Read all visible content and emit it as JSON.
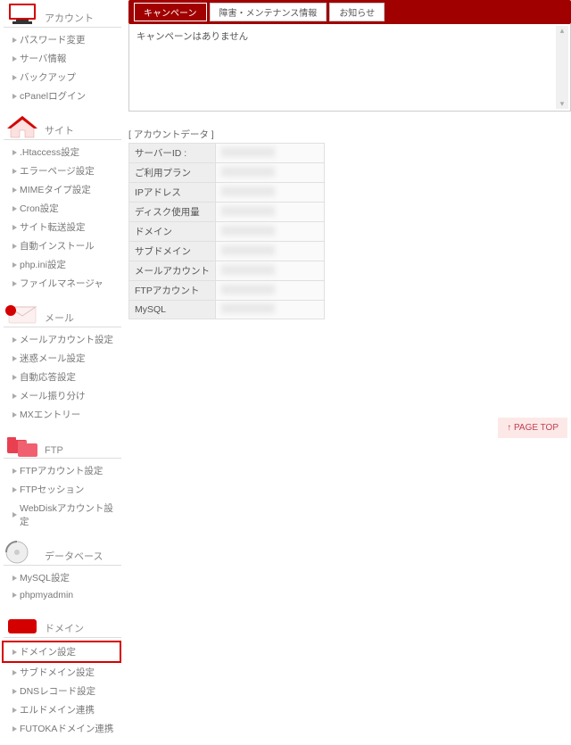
{
  "sidebar": {
    "account": {
      "label": "アカウント",
      "items": [
        "パスワード変更",
        "サーバ情報",
        "バックアップ",
        "cPanelログイン"
      ]
    },
    "site": {
      "label": "サイト",
      "items": [
        ".Htaccess設定",
        "エラーページ設定",
        "MIMEタイプ設定",
        "Cron設定",
        "サイト転送設定",
        "自動インストール",
        "php.ini設定",
        "ファイルマネージャ"
      ]
    },
    "mail": {
      "label": "メール",
      "items": [
        "メールアカウント設定",
        "迷惑メール設定",
        "自動応答設定",
        "メール振り分け",
        "MXエントリー"
      ]
    },
    "ftp": {
      "label": "FTP",
      "items": [
        "FTPアカウント設定",
        "FTPセッション",
        "WebDiskアカウント設定"
      ]
    },
    "db": {
      "label": "データベース",
      "items": [
        "MySQL設定",
        "phpmyadmin"
      ]
    },
    "domain": {
      "label": "ドメイン",
      "items": [
        "ドメイン設定",
        "サブドメイン設定",
        "DNSレコード設定",
        "エルドメイン連携",
        "FUTOKAドメイン連携"
      ],
      "selected_index": 0
    }
  },
  "tabs": {
    "items": [
      "キャンペーン",
      "障害・メンテナンス情報",
      "お知らせ"
    ],
    "active_index": 0,
    "content": "キャンペーンはありません"
  },
  "account_data": {
    "title": "[ アカウントデータ ]",
    "rows": [
      {
        "label": "サーバーID :",
        "value": ""
      },
      {
        "label": "ご利用プラン",
        "value": ""
      },
      {
        "label": "IPアドレス",
        "value": ""
      },
      {
        "label": "ディスク使用量",
        "value": ""
      },
      {
        "label": "ドメイン",
        "value": ""
      },
      {
        "label": "サブドメイン",
        "value": ""
      },
      {
        "label": "メールアカウント",
        "value": ""
      },
      {
        "label": "FTPアカウント",
        "value": ""
      },
      {
        "label": "MySQL",
        "value": ""
      }
    ]
  },
  "page_top": "↑ PAGE TOP"
}
